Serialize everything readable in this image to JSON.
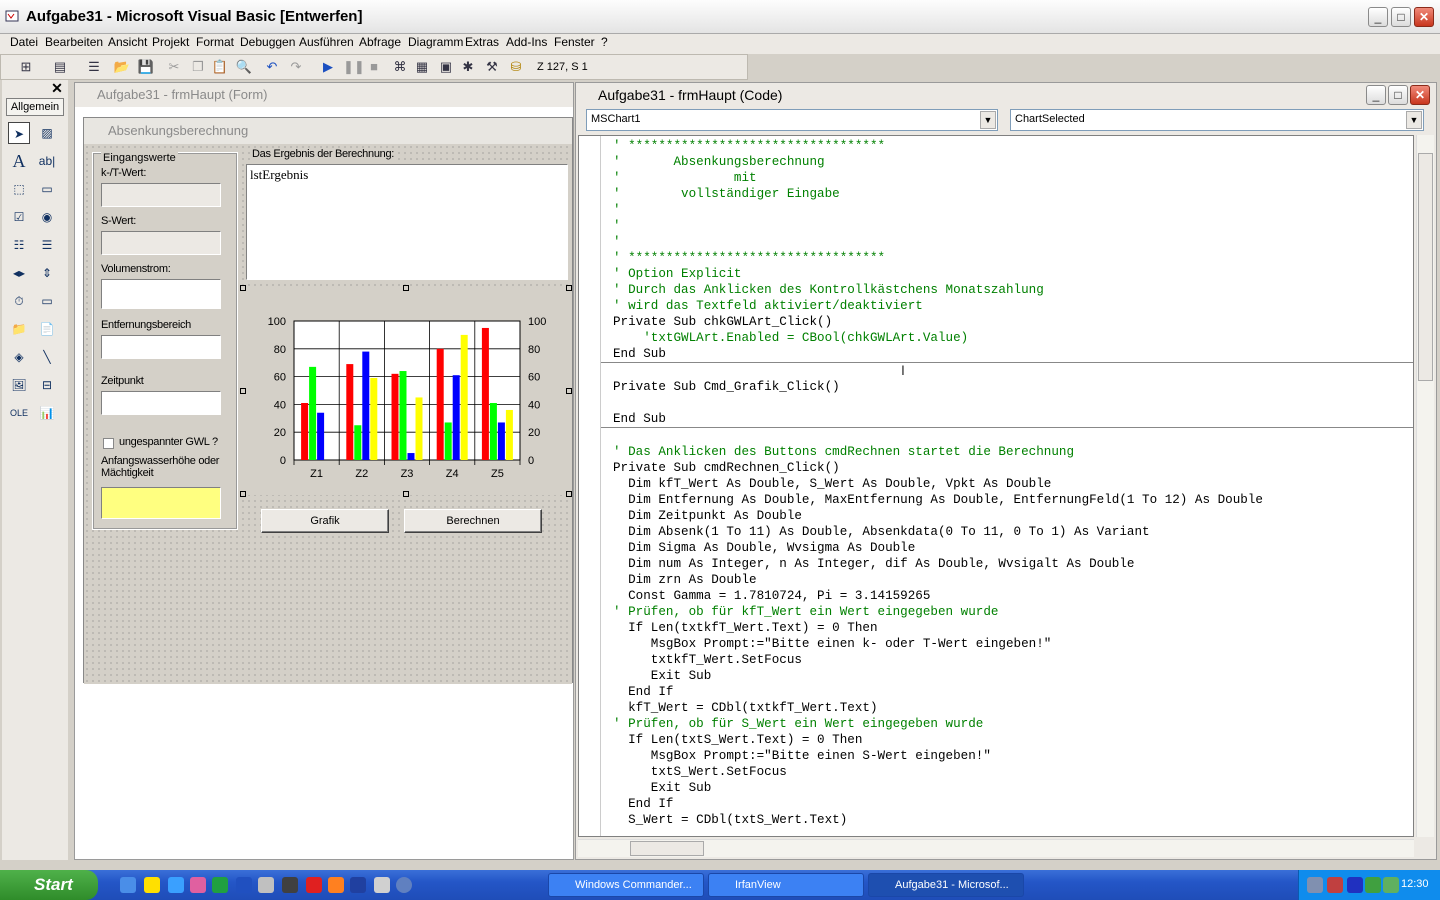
{
  "window": {
    "title": "Aufgabe31 - Microsoft Visual Basic [Entwerfen]"
  },
  "menu": [
    "Datei",
    "Bearbeiten",
    "Ansicht",
    "Projekt",
    "Format",
    "Debuggen",
    "Ausführen",
    "Abfrage",
    "Diagramm",
    "Extras",
    "Add-Ins",
    "Fenster",
    "?"
  ],
  "toolbar": {
    "position": "Z 127, S 1"
  },
  "toolbox": {
    "tab": "Allgemein"
  },
  "form_window": {
    "title": "Aufgabe31 - frmHaupt (Form)",
    "form_caption": "Absenkungsberechnung",
    "group_label": "Eingangswerte",
    "fields": {
      "kft": "k-/T-Wert:",
      "swert": "S-Wert:",
      "volumen": "Volumenstrom:",
      "entfernung": "Entfernungsbereich",
      "zeitpunkt": "Zeitpunkt",
      "anfang": "Anfangswasserhöhe oder Mächtigkeit"
    },
    "checkbox_label": "ungespannter GWL ?",
    "result_label": "Das Ergebnis der Berechnung:",
    "list_text": "lstErgebnis",
    "btn_grafik": "Grafik",
    "btn_berechnen": "Berechnen"
  },
  "chart_data": {
    "type": "bar",
    "categories": [
      "Z1",
      "Z2",
      "Z3",
      "Z4",
      "Z5"
    ],
    "series": [
      {
        "values": [
          41,
          69,
          62,
          80,
          95
        ],
        "color": "#ff0000"
      },
      {
        "values": [
          67,
          25,
          64,
          27,
          41
        ],
        "color": "#00ff00"
      },
      {
        "values": [
          34,
          78,
          5,
          61,
          27
        ],
        "color": "#0000ff"
      },
      {
        "values": [
          0,
          59,
          45,
          90,
          36
        ],
        "color": "#ffff00"
      }
    ],
    "ylim": [
      0,
      100
    ],
    "yticks": [
      "0",
      "20",
      "40",
      "60",
      "80",
      "100"
    ],
    "grid": true
  },
  "code_window": {
    "title": "Aufgabe31 - frmHaupt (Code)",
    "object": "MSChart1",
    "procedure": "ChartSelected",
    "lines": [
      {
        "t": "' **********************************",
        "c": 1
      },
      {
        "t": "'       Absenkungsberechnung",
        "c": 1
      },
      {
        "t": "'               mit",
        "c": 1
      },
      {
        "t": "'        vollständiger Eingabe",
        "c": 1
      },
      {
        "t": "'",
        "c": 1
      },
      {
        "t": "'",
        "c": 1
      },
      {
        "t": "'",
        "c": 1
      },
      {
        "t": "' **********************************",
        "c": 1
      },
      {
        "t": "' Option Explicit",
        "c": 1
      },
      {
        "t": "' Durch das Anklicken des Kontrollkästchens Monatszahlung",
        "c": 1
      },
      {
        "t": "' wird das Textfeld aktiviert/deaktiviert",
        "c": 1
      },
      {
        "t": "Private Sub chkGWLArt_Click()",
        "c": 0
      },
      {
        "t": "    'txtGWLArt.Enabled = CBool(chkGWLArt.Value)",
        "c": 1
      },
      {
        "t": "End Sub",
        "c": 0,
        "sep": 1
      },
      {
        "t": "",
        "c": 0
      },
      {
        "t": "Private Sub Cmd_Grafik_Click()",
        "c": 0
      },
      {
        "t": "",
        "c": 0
      },
      {
        "t": "End Sub",
        "c": 0,
        "sep": 1
      },
      {
        "t": "",
        "c": 0
      },
      {
        "t": "' Das Anklicken des Buttons cmdRechnen startet die Berechnung",
        "c": 1
      },
      {
        "t": "Private Sub cmdRechnen_Click()",
        "c": 0
      },
      {
        "t": "  Dim kfT_Wert As Double, S_Wert As Double, Vpkt As Double",
        "c": 0
      },
      {
        "t": "  Dim Entfernung As Double, MaxEntfernung As Double, EntfernungFeld(1 To 12) As Double",
        "c": 0
      },
      {
        "t": "  Dim Zeitpunkt As Double",
        "c": 0
      },
      {
        "t": "  Dim Absenk(1 To 11) As Double, Absenkdata(0 To 11, 0 To 1) As Variant",
        "c": 0
      },
      {
        "t": "  Dim Sigma As Double, Wvsigma As Double",
        "c": 0
      },
      {
        "t": "  Dim num As Integer, n As Integer, dif As Double, Wvsigalt As Double",
        "c": 0
      },
      {
        "t": "  Dim zrn As Double",
        "c": 0
      },
      {
        "t": "  Const Gamma = 1.7810724, Pi = 3.14159265",
        "c": 0
      },
      {
        "t": "' Prüfen, ob für kfT_Wert ein Wert eingegeben wurde",
        "c": 1
      },
      {
        "t": "  If Len(txtkfT_Wert.Text) = 0 Then",
        "c": 0
      },
      {
        "t": "     MsgBox Prompt:=\"Bitte einen k- oder T-Wert eingeben!\"",
        "c": 0
      },
      {
        "t": "     txtkfT_Wert.SetFocus",
        "c": 0
      },
      {
        "t": "     Exit Sub",
        "c": 0
      },
      {
        "t": "  End If",
        "c": 0
      },
      {
        "t": "  kfT_Wert = CDbl(txtkfT_Wert.Text)",
        "c": 0
      },
      {
        "t": "' Prüfen, ob für S_Wert ein Wert eingegeben wurde",
        "c": 1
      },
      {
        "t": "  If Len(txtS_Wert.Text) = 0 Then",
        "c": 0
      },
      {
        "t": "     MsgBox Prompt:=\"Bitte einen S-Wert eingeben!\"",
        "c": 0
      },
      {
        "t": "     txtS_Wert.SetFocus",
        "c": 0
      },
      {
        "t": "     Exit Sub",
        "c": 0
      },
      {
        "t": "  End If",
        "c": 0
      },
      {
        "t": "  S_Wert = CDbl(txtS_Wert.Text)",
        "c": 0
      }
    ]
  },
  "taskbar": {
    "start": "Start",
    "tasks": [
      "Windows Commander...",
      "IrfanView",
      "Aufgabe31 - Microsof..."
    ],
    "clock": "12:30"
  }
}
